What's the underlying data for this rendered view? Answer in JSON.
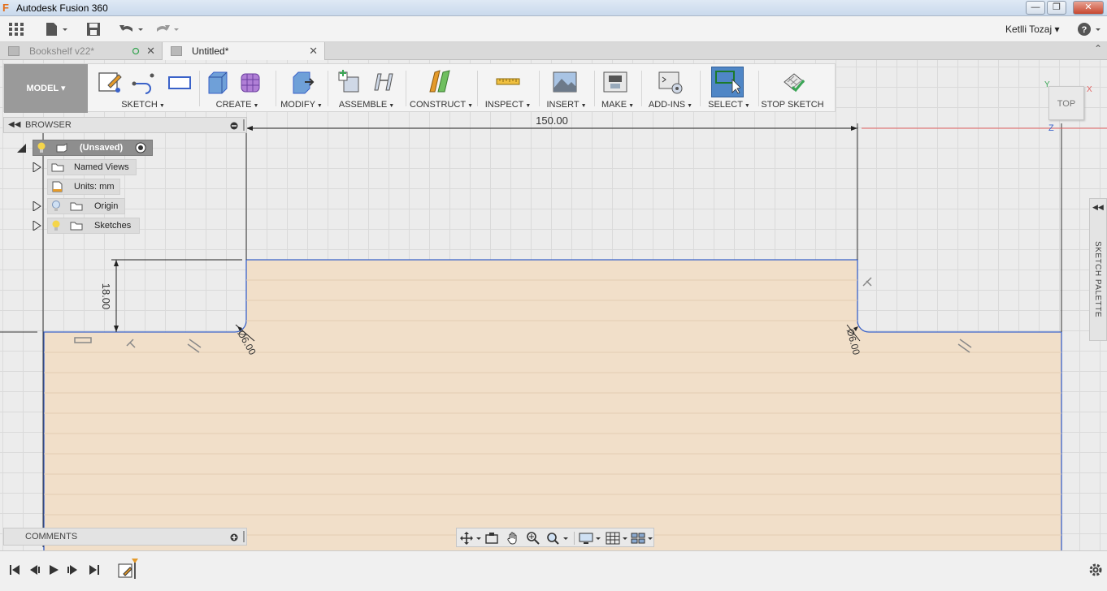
{
  "window": {
    "title": "Autodesk Fusion 360"
  },
  "qat": {
    "user": "Ketlli Tozaj"
  },
  "tabs": [
    {
      "label": "Bookshelf v22*"
    },
    {
      "label": "Untitled*"
    }
  ],
  "ribbon": {
    "workspace": "MODEL",
    "groups": [
      {
        "label": "SKETCH"
      },
      {
        "label": "CREATE"
      },
      {
        "label": "MODIFY"
      },
      {
        "label": "ASSEMBLE"
      },
      {
        "label": "CONSTRUCT"
      },
      {
        "label": "INSPECT"
      },
      {
        "label": "INSERT"
      },
      {
        "label": "MAKE"
      },
      {
        "label": "ADD-INS"
      },
      {
        "label": "SELECT"
      },
      {
        "label": "STOP SKETCH"
      }
    ]
  },
  "browser": {
    "title": "BROWSER",
    "items": [
      {
        "label": "(Unsaved)"
      },
      {
        "label": "Named Views"
      },
      {
        "label": "Units: mm"
      },
      {
        "label": "Origin"
      },
      {
        "label": "Sketches"
      }
    ]
  },
  "comments": {
    "title": "COMMENTS"
  },
  "viewcube": {
    "label": "TOP",
    "axis_x": "X",
    "axis_y": "Y",
    "axis_z": "Z"
  },
  "palette": {
    "title": "SKETCH PALETTE"
  },
  "dimensions": {
    "width": "150.00",
    "height": "18.00",
    "diameter_left": "Ø6.00",
    "diameter_right": "Ø6.00"
  },
  "colors": {
    "profile_fill": "#f1dfc9",
    "sketch_line": "#3a62c9",
    "select_active": "#4f86c6"
  }
}
